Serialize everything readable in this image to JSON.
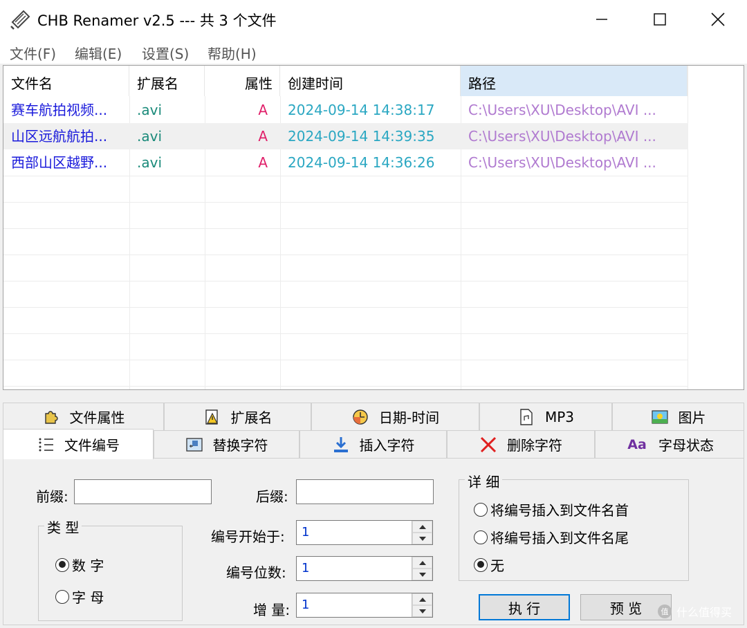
{
  "window": {
    "title": "CHB Renamer v2.5 --- 共 3 个文件"
  },
  "menu": [
    "文件(F)",
    "编辑(E)",
    "设置(S)",
    "帮助(H)"
  ],
  "list": {
    "headers": [
      "文件名",
      "扩展名",
      "属性",
      "创建时间",
      "路径"
    ],
    "rows": [
      {
        "name": "赛车航拍视频...",
        "ext": ".avi",
        "attr": "A",
        "created": "2024-09-14 14:38:17",
        "path": "C:\\Users\\XU\\Desktop\\AVI ..."
      },
      {
        "name": "山区远航航拍...",
        "ext": ".avi",
        "attr": "A",
        "created": "2024-09-14 14:39:35",
        "path": "C:\\Users\\XU\\Desktop\\AVI ..."
      },
      {
        "name": "西部山区越野...",
        "ext": ".avi",
        "attr": "A",
        "created": "2024-09-14 14:36:26",
        "path": "C:\\Users\\XU\\Desktop\\AVI ..."
      }
    ],
    "colors": {
      "name": "#1a1adb",
      "ext": "#1a8a7a",
      "attr": "#e0206a",
      "created": "#2aa7c2",
      "path": "#b07ad0"
    }
  },
  "tabs_top": [
    {
      "label": "文件属性",
      "icon": "puzzle-icon"
    },
    {
      "label": "扩展名",
      "icon": "warning-document-icon"
    },
    {
      "label": "日期-时间",
      "icon": "clock-icon"
    },
    {
      "label": "MP3",
      "icon": "music-document-icon"
    },
    {
      "label": "图片",
      "icon": "picture-icon"
    }
  ],
  "tabs_bottom": [
    {
      "label": "文件编号",
      "icon": "numbered-list-icon",
      "active": true
    },
    {
      "label": "替换字符",
      "icon": "replace-icon"
    },
    {
      "label": "插入字符",
      "icon": "insert-down-icon"
    },
    {
      "label": "删除字符",
      "icon": "delete-x-icon"
    },
    {
      "label": "字母状态",
      "icon": "letter-case-icon",
      "icon_text": "Aa"
    }
  ],
  "numbering": {
    "prefix_label": "前缀:",
    "prefix_value": "",
    "suffix_label": "后缀:",
    "suffix_value": "",
    "type_group": "类 型",
    "type_options": [
      {
        "label": "数 字",
        "selected": true
      },
      {
        "label": "字 母",
        "selected": false
      }
    ],
    "start_label": "编号开始于:",
    "start_value": "1",
    "digits_label": "编号位数:",
    "digits_value": "1",
    "increment_label": "增 量:",
    "increment_value": "1",
    "detail_group": "详 细",
    "detail_options": [
      {
        "label": "将编号插入到文件名首",
        "selected": false
      },
      {
        "label": "将编号插入到文件名尾",
        "selected": false
      },
      {
        "label": "无",
        "selected": true
      }
    ],
    "execute_label": "执 行",
    "preview_label": "预 览"
  },
  "watermark": "什么值得买"
}
